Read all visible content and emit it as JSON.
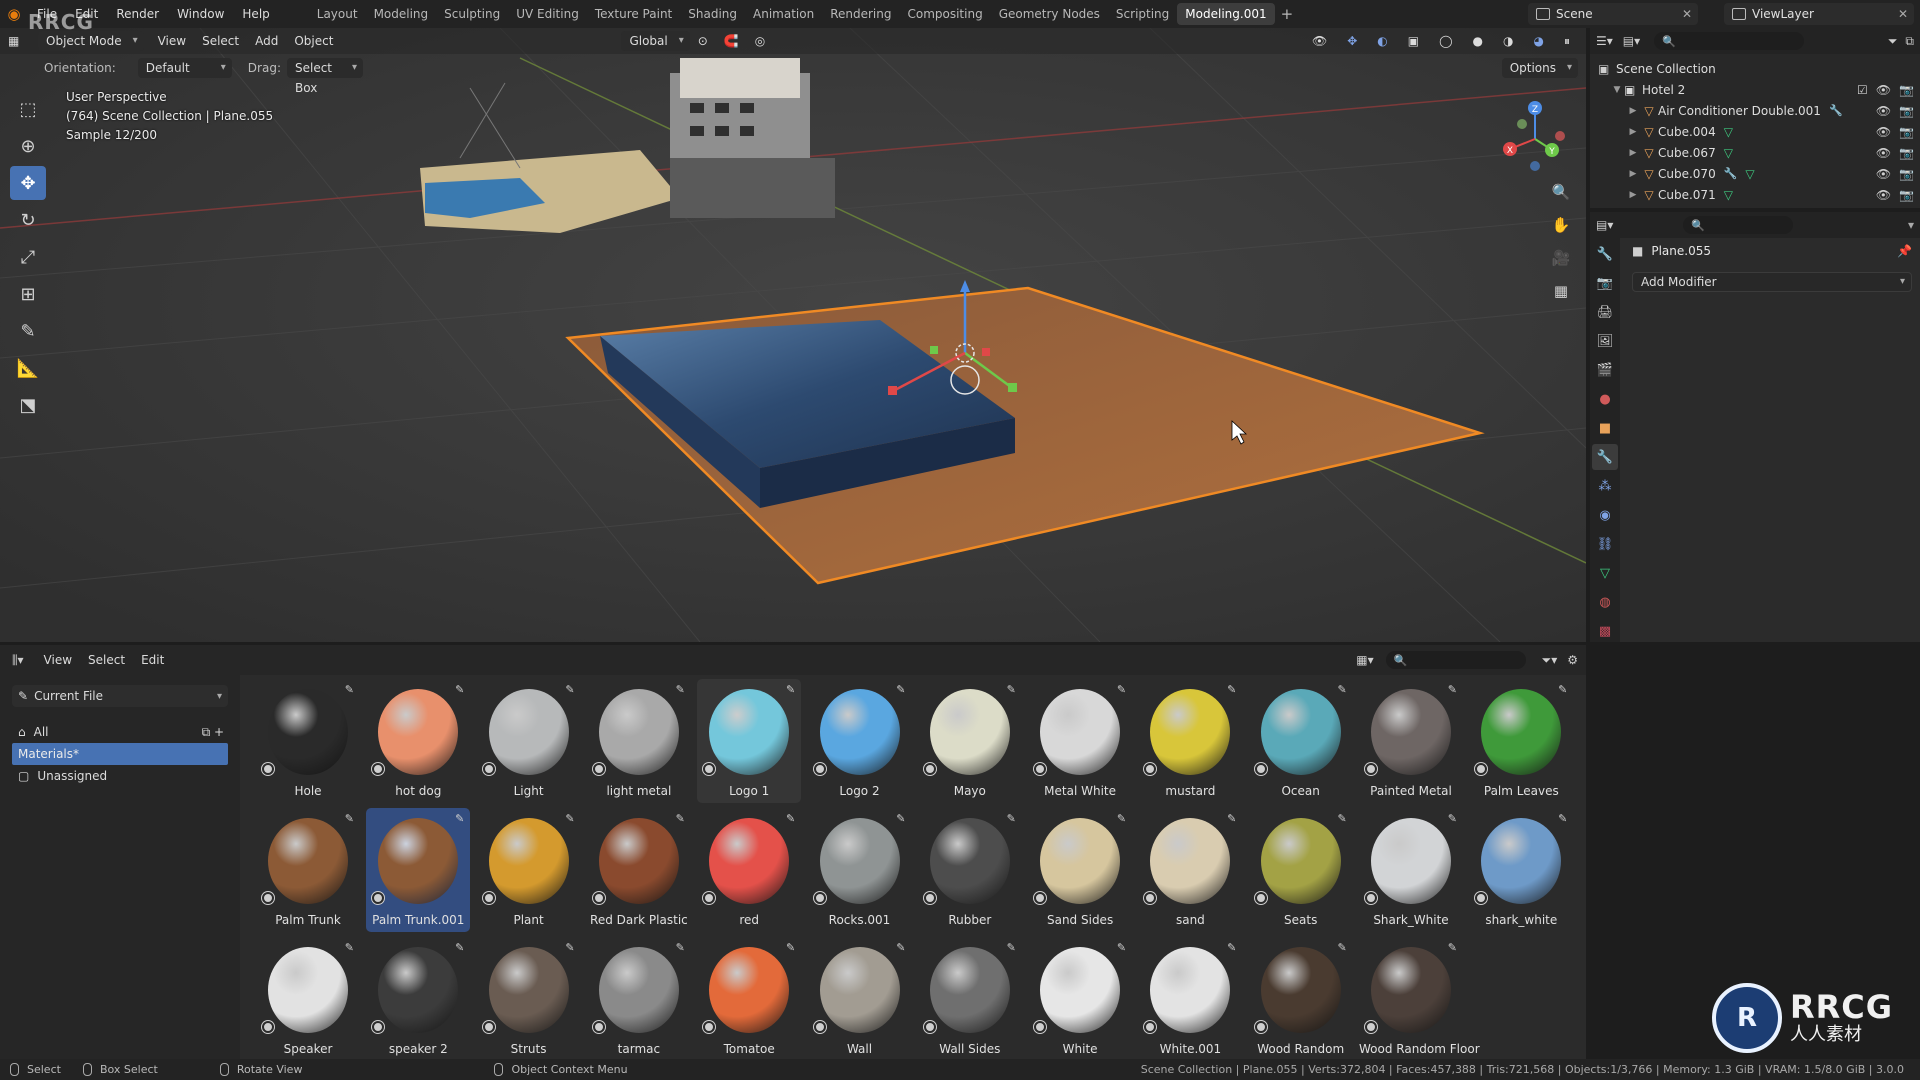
{
  "brand_top_left": "RRCG",
  "menu": [
    "File",
    "Edit",
    "Render",
    "Window",
    "Help"
  ],
  "workspaces": [
    "Layout",
    "Modeling",
    "Sculpting",
    "UV Editing",
    "Texture Paint",
    "Shading",
    "Animation",
    "Rendering",
    "Compositing",
    "Geometry Nodes",
    "Scripting",
    "Modeling.001"
  ],
  "active_workspace": "Modeling.001",
  "scene_name": "Scene",
  "view_layer": "ViewLayer",
  "viewport": {
    "mode": "Object Mode",
    "menus": [
      "View",
      "Select",
      "Add",
      "Object"
    ],
    "transform_orientation": "Global",
    "orientation_label": "Orientation:",
    "orientation_value": "Default",
    "drag_label": "Drag:",
    "drag_value": "Select Box",
    "options_label": "Options",
    "overlay_line1": "User Perspective",
    "overlay_line2": "(764) Scene Collection | Plane.055",
    "overlay_line3": "Sample 12/200"
  },
  "gizmo_axes": {
    "x": "X",
    "y": "Y",
    "z": "Z"
  },
  "outliner": {
    "root": "Scene Collection",
    "collection": "Hotel 2",
    "items": [
      {
        "name": "Air Conditioner Double.001",
        "mesh": false,
        "wrench": true
      },
      {
        "name": "Cube.004",
        "mesh": true,
        "wrench": false
      },
      {
        "name": "Cube.067",
        "mesh": true,
        "wrench": false
      },
      {
        "name": "Cube.070",
        "mesh": true,
        "wrench": true
      },
      {
        "name": "Cube.071",
        "mesh": true,
        "wrench": false
      }
    ]
  },
  "properties": {
    "object_name": "Plane.055",
    "add_modifier": "Add Modifier"
  },
  "asset_browser": {
    "menus": [
      "View",
      "Select",
      "Edit"
    ],
    "library": "Current File",
    "categories": {
      "all": "All",
      "materials": "Materials*",
      "unassigned": "Unassigned"
    },
    "materials": [
      {
        "name": "Hole",
        "color": "#2a2a2a"
      },
      {
        "name": "hot dog",
        "color": "#e8906c"
      },
      {
        "name": "Light",
        "color": "#b7b9ba"
      },
      {
        "name": "light metal",
        "color": "#a9a9a9"
      },
      {
        "name": "Logo 1",
        "color": "#74c7db"
      },
      {
        "name": "Logo 2",
        "color": "#5aa7e0"
      },
      {
        "name": "Mayo",
        "color": "#dcdcc8"
      },
      {
        "name": "Metal White",
        "color": "#d8d8d8"
      },
      {
        "name": "mustard",
        "color": "#d8c63a"
      },
      {
        "name": "Ocean",
        "color": "#5aa9b8"
      },
      {
        "name": "Painted Metal",
        "color": "#6e6664"
      },
      {
        "name": "Palm Leaves",
        "color": "#3f9a3a"
      },
      {
        "name": "Palm Trunk",
        "color": "#8c5a36"
      },
      {
        "name": "Palm Trunk.001",
        "color": "#8c5a36"
      },
      {
        "name": "Plant",
        "color": "#d49a2e"
      },
      {
        "name": "Red Dark Plastic",
        "color": "#8a4a2e"
      },
      {
        "name": "red",
        "color": "#e4514a"
      },
      {
        "name": "Rocks.001",
        "color": "#8f9494"
      },
      {
        "name": "Rubber",
        "color": "#4d4d4d"
      },
      {
        "name": "Sand Sides",
        "color": "#d6c69e"
      },
      {
        "name": "sand",
        "color": "#d9ccb0"
      },
      {
        "name": "Seats",
        "color": "#a3a245"
      },
      {
        "name": "Shark_White",
        "color": "#d2d4d6"
      },
      {
        "name": "shark_white",
        "color": "#6e9ac8"
      },
      {
        "name": "Speaker",
        "color": "#e2e2e2"
      },
      {
        "name": "speaker 2",
        "color": "#3c3c3c"
      },
      {
        "name": "Struts",
        "color": "#6a5c52"
      },
      {
        "name": "tarmac",
        "color": "#8a8a8a"
      },
      {
        "name": "Tomatoe",
        "color": "#e36a3a"
      },
      {
        "name": "Wall",
        "color": "#a29c92"
      },
      {
        "name": "Wall Sides",
        "color": "#6f6f6f"
      },
      {
        "name": "White",
        "color": "#e6e6e6"
      },
      {
        "name": "White.001",
        "color": "#e3e3e3"
      },
      {
        "name": "Wood Random",
        "color": "#4a3b30"
      },
      {
        "name": "Wood Random Floor",
        "color": "#4c403a"
      }
    ],
    "selected": "Palm Trunk.001",
    "hovered": "Logo 1"
  },
  "statusbar": {
    "select": "Select",
    "box_select": "Box Select",
    "rotate_view": "Rotate View",
    "context_menu": "Object Context Menu",
    "stats": "Scene Collection | Plane.055 | Verts:372,804 | Faces:457,388 | Tris:721,568 | Objects:1/3,766 | Memory: 1.3 GiB | VRAM: 1.5/8.0 GiB | 3.0.0"
  },
  "watermark": {
    "big": "RRCG",
    "small": "人人素材",
    "circle": "R"
  },
  "colors": {
    "accent": "#4772b3",
    "selection_orange": "#f08a24",
    "mesh_green": "#3ec97f"
  }
}
